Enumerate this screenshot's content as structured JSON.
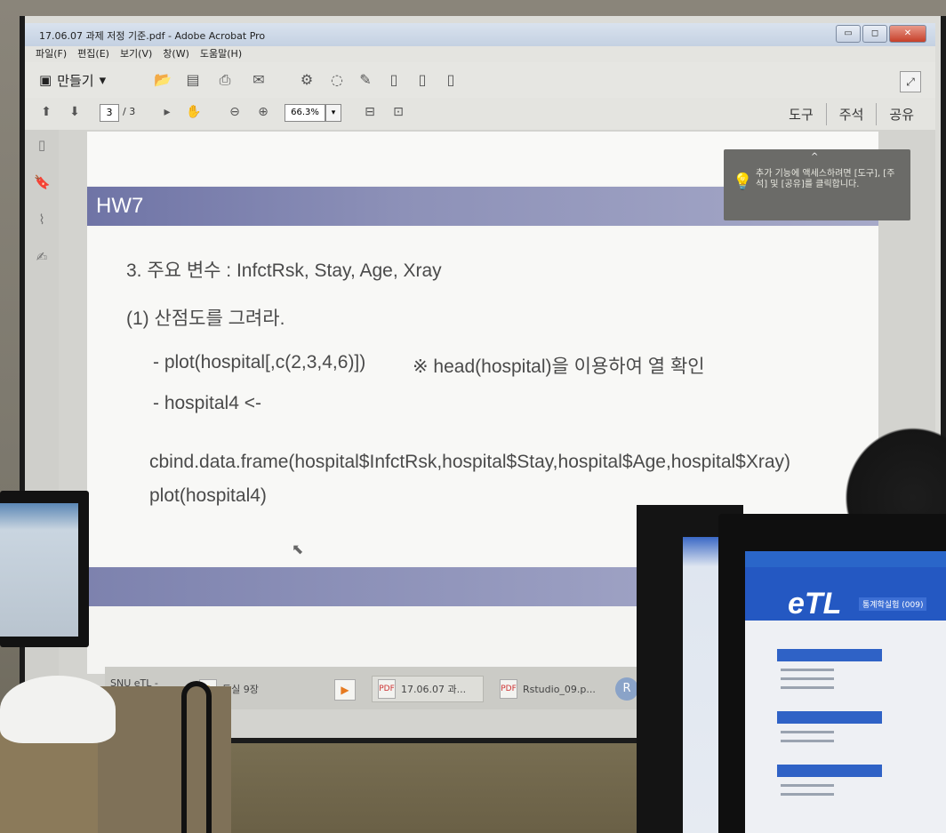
{
  "window": {
    "title": "17.06.07 과제 저정 기준.pdf - Adobe Acrobat Pro",
    "buttons": {
      "minimize": "▭",
      "maximize": "◻",
      "close": "✕"
    }
  },
  "menubar": {
    "items": [
      "파일(F)",
      "편집(E)",
      "보기(V)",
      "창(W)",
      "도움말(H)"
    ]
  },
  "toolbar": {
    "create_label": "만들기",
    "create_arrow": "▾",
    "icons": [
      "open-folder-icon",
      "save-icon",
      "print-icon",
      "email-icon",
      "settings-icon",
      "comment-icon",
      "stamp-icon",
      "pdf-icon",
      "pdf-export-icon",
      "pdf-combine-icon"
    ]
  },
  "navigation": {
    "current_page": "3",
    "total_pages": "/ 3",
    "zoom": "66.3%",
    "zoom_arrow": "▾"
  },
  "right_tabs": [
    "도구",
    "주석",
    "공유"
  ],
  "tooltip": {
    "caret": "^",
    "text": "추가 기능에 액세스하려면 [도구], [주석] 및 [공유]를 클릭합니다."
  },
  "document": {
    "header": "HW7",
    "lines": [
      "3. 주요 변수 : InfctRsk, Stay, Age, Xray",
      "(1) 산점도를 그려라.",
      "- plot(hospital[,c(2,3,4,6)])",
      "※ head(hospital)을 이용하여 열 확인",
      "- hospital4 <-",
      "cbind.data.frame(hospital$InfctRsk,hospital$Stay,hospital$Age,hospital$Xray)",
      "plot(hospital4)"
    ]
  },
  "taskbar": {
    "items": [
      {
        "label": "SNU eTL - In..."
      },
      {
        "label": "통실 9장"
      },
      {
        "label": "17.06.07 과..."
      },
      {
        "label": "Rstudio_09.p..."
      }
    ],
    "r_label": "R"
  },
  "foreground_monitor": {
    "logo": "eTL",
    "subtitle": "통계학실험 (009)"
  }
}
